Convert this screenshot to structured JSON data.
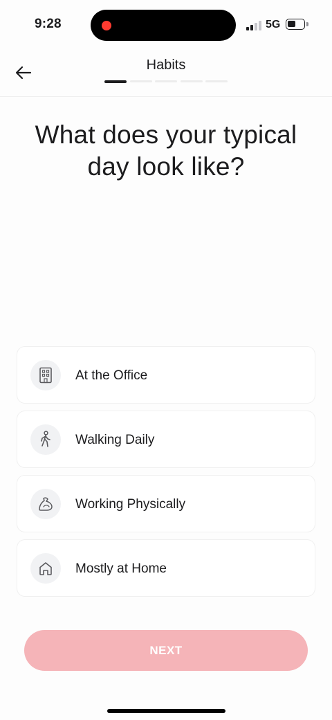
{
  "status_bar": {
    "time": "9:28",
    "network": "5G",
    "battery_level": 0.55,
    "signal_bars_active": 2,
    "recording_color": "#ff3b30"
  },
  "header": {
    "back_icon": "arrow-left-icon",
    "title": "Habits",
    "progress": {
      "total_steps": 5,
      "current_step": 1
    }
  },
  "question": {
    "line1": "What does your typical",
    "line2": "day look like?"
  },
  "options": [
    {
      "label": "At the Office",
      "icon": "office-building-icon"
    },
    {
      "label": "Walking Daily",
      "icon": "walking-person-icon"
    },
    {
      "label": "Working Physically",
      "icon": "flexed-arm-icon"
    },
    {
      "label": "Mostly at Home",
      "icon": "home-icon"
    }
  ],
  "next_button": {
    "label": "NEXT",
    "enabled": false,
    "color": "#f5b4b8"
  }
}
